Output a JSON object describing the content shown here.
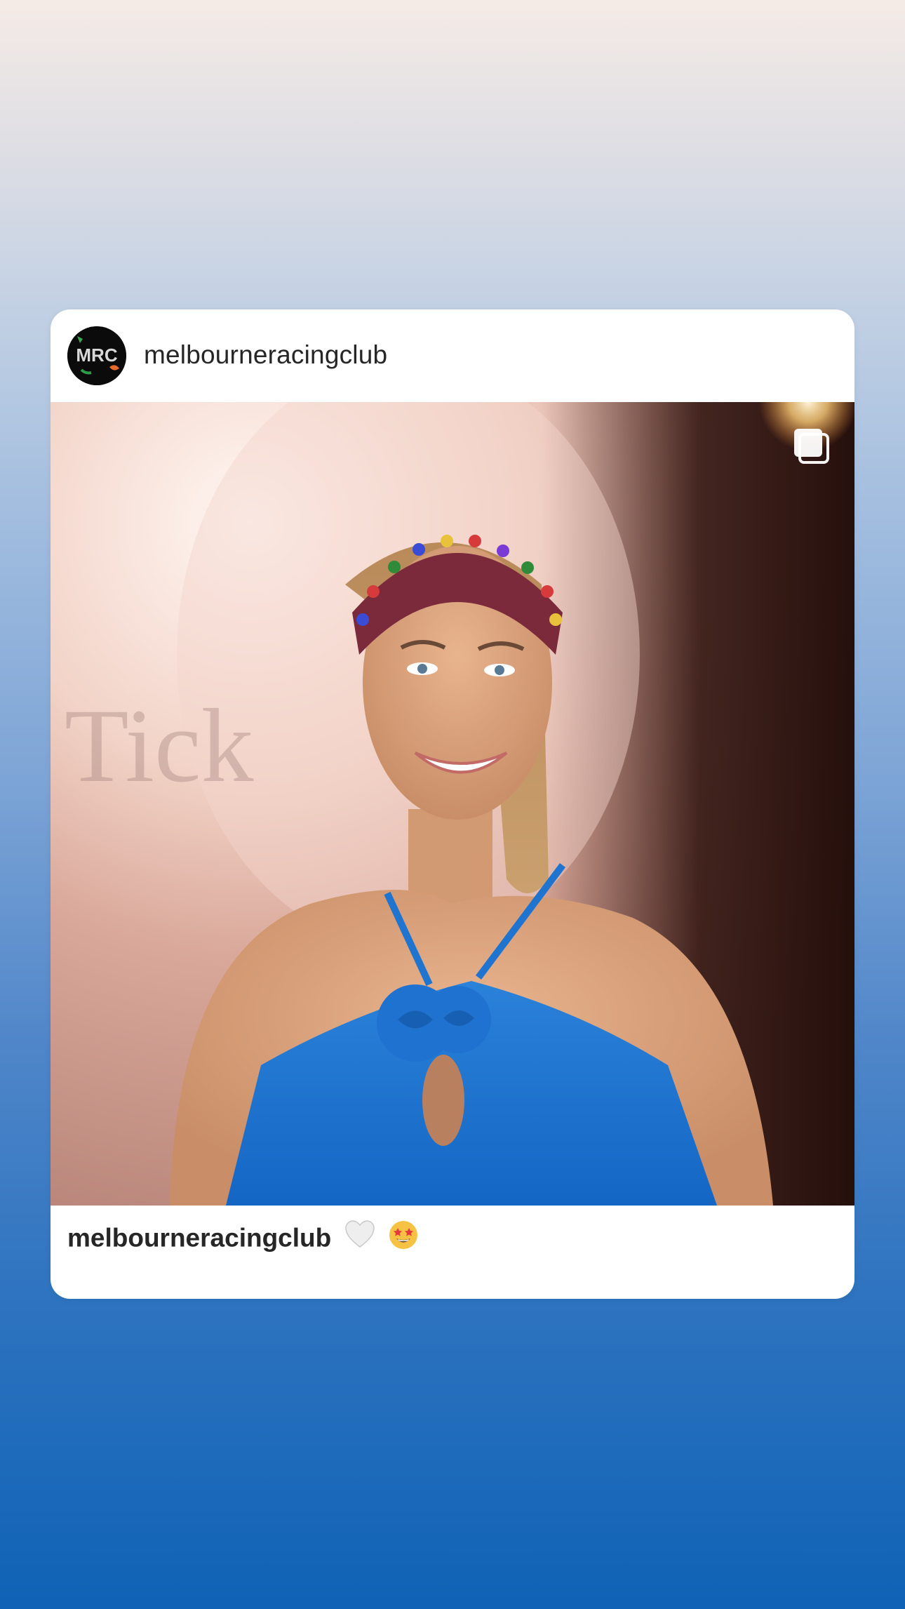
{
  "post": {
    "username": "melbourneracingclub",
    "avatar_text": "MRC",
    "caption": {
      "username": "melbourneracingclub",
      "emojis": [
        "white-heart",
        "star-struck-face"
      ]
    },
    "media_indicator_icon": "carousel-multiple-icon"
  },
  "colors": {
    "background_top": "#f5ebe6",
    "background_bottom": "#0f62b6",
    "card": "#ffffff",
    "text": "#262626"
  }
}
